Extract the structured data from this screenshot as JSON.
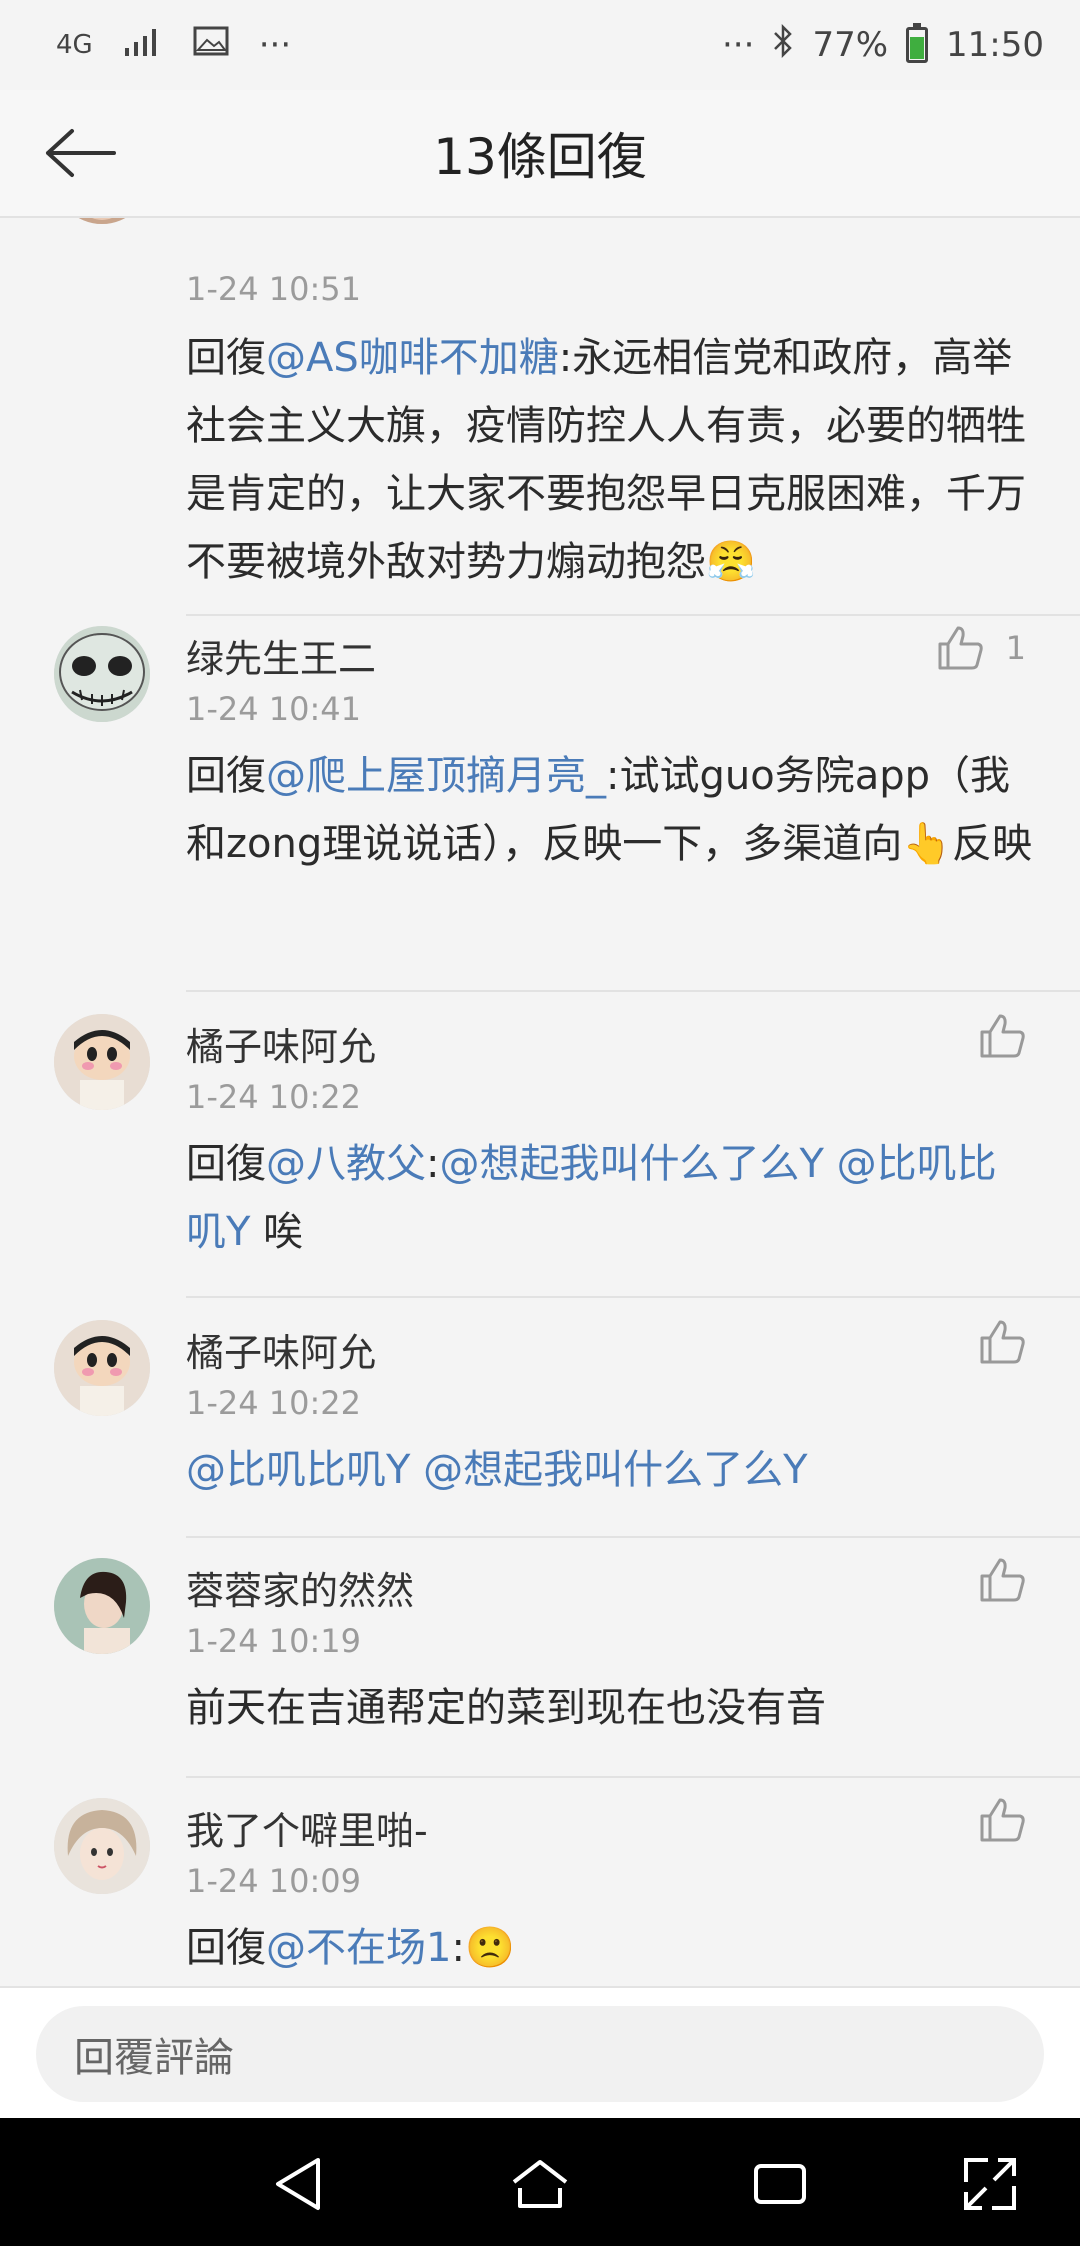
{
  "status_bar": {
    "network": "4G",
    "more": "···",
    "more_right": "···",
    "battery": "77%",
    "time": "11:50"
  },
  "header": {
    "title": "13條回復"
  },
  "comments": [
    {
      "time": "1-24 10:51",
      "reply_prefix": "回復",
      "mention": "@AS咖啡不加糖",
      "text": ":永远相信党和政府，高举社会主义大旗，疫情防控人人有责，必要的牺牲是肯定的，让大家不要抱怨早日克服困难，千万不要被境外敌对势力煽动抱怨",
      "emoji": "😤"
    },
    {
      "user": "绿先生王二",
      "time": "1-24 10:41",
      "likes": "1",
      "reply_prefix": "回復",
      "mention": "@爬上屋顶摘月亮_",
      "text": ":试试guo务院app（我和zong理说说话），反映一下，多渠道向👆反映"
    },
    {
      "user": "橘子味阿允",
      "time": "1-24 10:22",
      "reply_prefix": "回復",
      "mention": "@八教父",
      "text_1": ":",
      "mention_2": "@想起我叫什么了么Y @比叽比叽Y",
      "text": " 唉"
    },
    {
      "user": "橘子味阿允",
      "time": "1-24 10:22",
      "mention": "@比叽比叽Y @想起我叫什么了么Y"
    },
    {
      "user": "蓉蓉家的然然",
      "time": "1-24 10:19",
      "text": "前天在吉通帮定的菜到现在也没有音"
    },
    {
      "user": "我了个噼里啪-",
      "time": "1-24 10:09",
      "reply_prefix": "回復",
      "mention": "@不在场1",
      "text": ":",
      "emoji": "🙁"
    }
  ],
  "reply_bar": {
    "placeholder": "回覆評論"
  },
  "colors": {
    "mention": "#4a7bb8",
    "battery": "#3fae3f"
  }
}
